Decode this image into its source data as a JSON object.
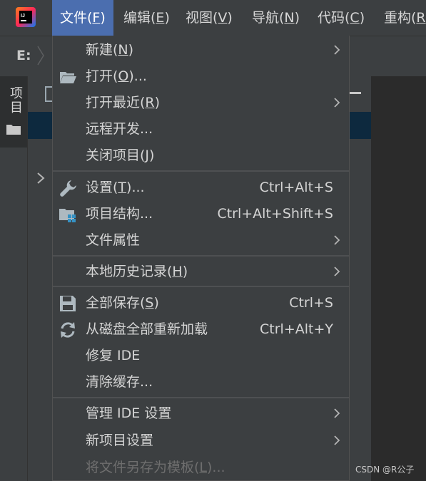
{
  "menubar": {
    "items": [
      {
        "label": "文件(",
        "mnemonic": "F",
        "tail": ")"
      },
      {
        "label": "编辑(",
        "mnemonic": "E",
        "tail": ")"
      },
      {
        "label": "视图(",
        "mnemonic": "V",
        "tail": ")"
      },
      {
        "label": "导航(",
        "mnemonic": "N",
        "tail": ")"
      },
      {
        "label": "代码(",
        "mnemonic": "C",
        "tail": ")"
      },
      {
        "label": "重构(",
        "mnemonic": "R",
        "tail": ""
      }
    ]
  },
  "breadcrumb": {
    "drive": "E:"
  },
  "sidebar": {
    "project_label": "项目"
  },
  "file_menu": {
    "items": [
      {
        "pre": "新建(",
        "mn": "N",
        "post": ")",
        "shortcut": "",
        "submenu": true,
        "icon": ""
      },
      {
        "pre": "打开(",
        "mn": "O",
        "post": ")...",
        "shortcut": "",
        "submenu": false,
        "icon": "folder-open-icon"
      },
      {
        "pre": "打开最近(",
        "mn": "R",
        "post": ")",
        "shortcut": "",
        "submenu": true,
        "icon": ""
      },
      {
        "pre": "远程开发...",
        "mn": "",
        "post": "",
        "shortcut": "",
        "submenu": false,
        "icon": ""
      },
      {
        "pre": "关闭项目(",
        "mn": "J",
        "post": ")",
        "shortcut": "",
        "submenu": false,
        "icon": ""
      },
      {
        "pre": "设置(",
        "mn": "T",
        "post": ")...",
        "shortcut": "Ctrl+Alt+S",
        "submenu": false,
        "icon": "wrench-icon"
      },
      {
        "pre": "项目结构...",
        "mn": "",
        "post": "",
        "shortcut": "Ctrl+Alt+Shift+S",
        "submenu": false,
        "icon": "project-structure-icon"
      },
      {
        "pre": "文件属性",
        "mn": "",
        "post": "",
        "shortcut": "",
        "submenu": true,
        "icon": ""
      },
      {
        "pre": "本地历史记录(",
        "mn": "H",
        "post": ")",
        "shortcut": "",
        "submenu": true,
        "icon": ""
      },
      {
        "pre": "全部保存(",
        "mn": "S",
        "post": ")",
        "shortcut": "Ctrl+S",
        "submenu": false,
        "icon": "save-icon"
      },
      {
        "pre": "从磁盘全部重新加载",
        "mn": "",
        "post": "",
        "shortcut": "Ctrl+Alt+Y",
        "submenu": false,
        "icon": "reload-icon"
      },
      {
        "pre": "修复 IDE",
        "mn": "",
        "post": "",
        "shortcut": "",
        "submenu": false,
        "icon": ""
      },
      {
        "pre": "清除缓存...",
        "mn": "",
        "post": "",
        "shortcut": "",
        "submenu": false,
        "icon": ""
      },
      {
        "pre": "管理 IDE 设置",
        "mn": "",
        "post": "",
        "shortcut": "",
        "submenu": true,
        "icon": ""
      },
      {
        "pre": "新项目设置",
        "mn": "",
        "post": "",
        "shortcut": "",
        "submenu": true,
        "icon": ""
      },
      {
        "pre": "将文件另存为模板(",
        "mn": "L",
        "post": ")...",
        "shortcut": "",
        "submenu": false,
        "icon": "",
        "disabled": true
      }
    ]
  },
  "watermark": "CSDN @R公子",
  "colors": {
    "menubar": "#3c3f41",
    "active": "#4b6eaf",
    "selection": "#0d293e",
    "text": "#d4d4d4",
    "disabled": "#6e6e6e"
  }
}
